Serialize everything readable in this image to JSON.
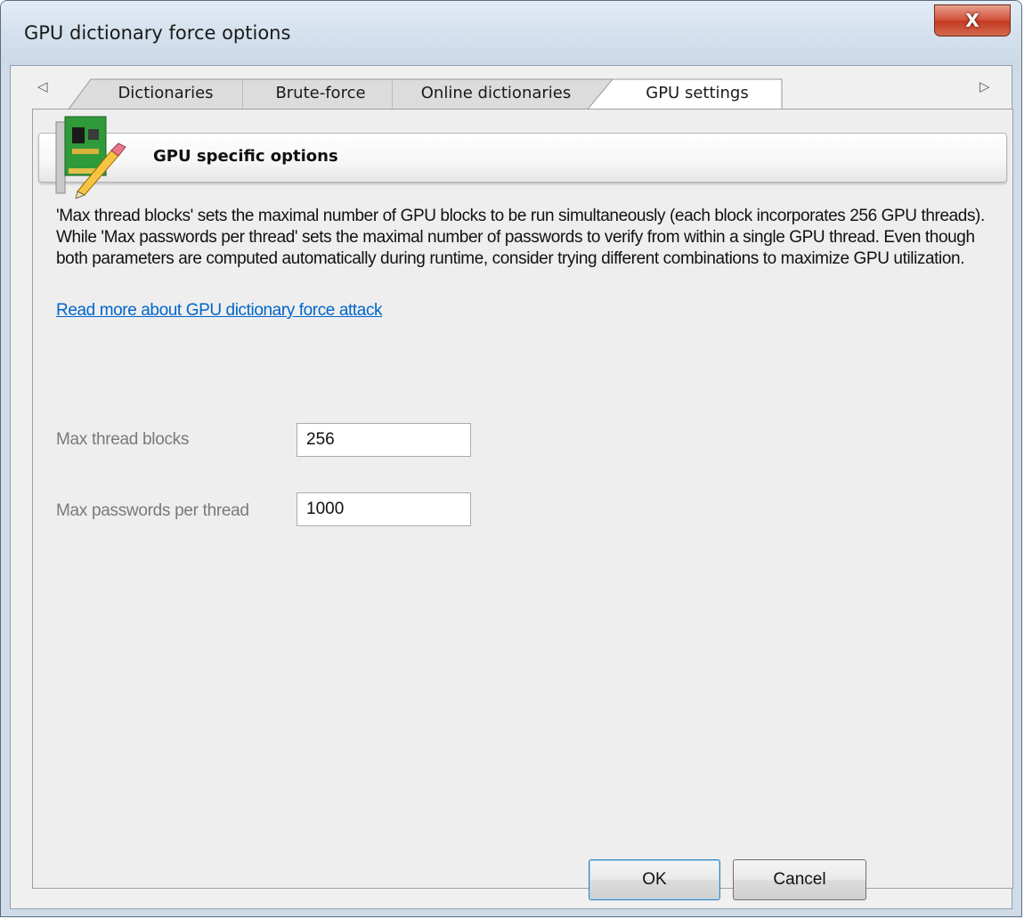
{
  "window": {
    "title": "GPU dictionary force options",
    "close_symbol": "X"
  },
  "tabs": {
    "scroll_left_symbol": "◁",
    "scroll_right_symbol": "▷",
    "items": [
      {
        "label": "Dictionaries",
        "active": false
      },
      {
        "label": "Brute-force",
        "active": false
      },
      {
        "label": "Online dictionaries",
        "active": false
      },
      {
        "label": "GPU settings",
        "active": true
      }
    ]
  },
  "section": {
    "title": "GPU specific options",
    "icon": "gpu-card-pencil-icon",
    "description": "'Max thread blocks' sets the maximal number of GPU blocks to be run simultaneously (each block incorporates 256 GPU threads). While 'Max passwords per thread' sets the maximal number of passwords to verify from within a single GPU thread. Even though both parameters are computed automatically during runtime, consider trying different combinations to maximize GPU utilization.",
    "link": "Read more about GPU dictionary force attack"
  },
  "fields": {
    "max_thread_blocks": {
      "label": "Max thread blocks",
      "value": "256"
    },
    "max_passwords_per_thread": {
      "label": "Max passwords per thread",
      "value": "1000"
    }
  },
  "buttons": {
    "ok": "OK",
    "cancel": "Cancel"
  }
}
